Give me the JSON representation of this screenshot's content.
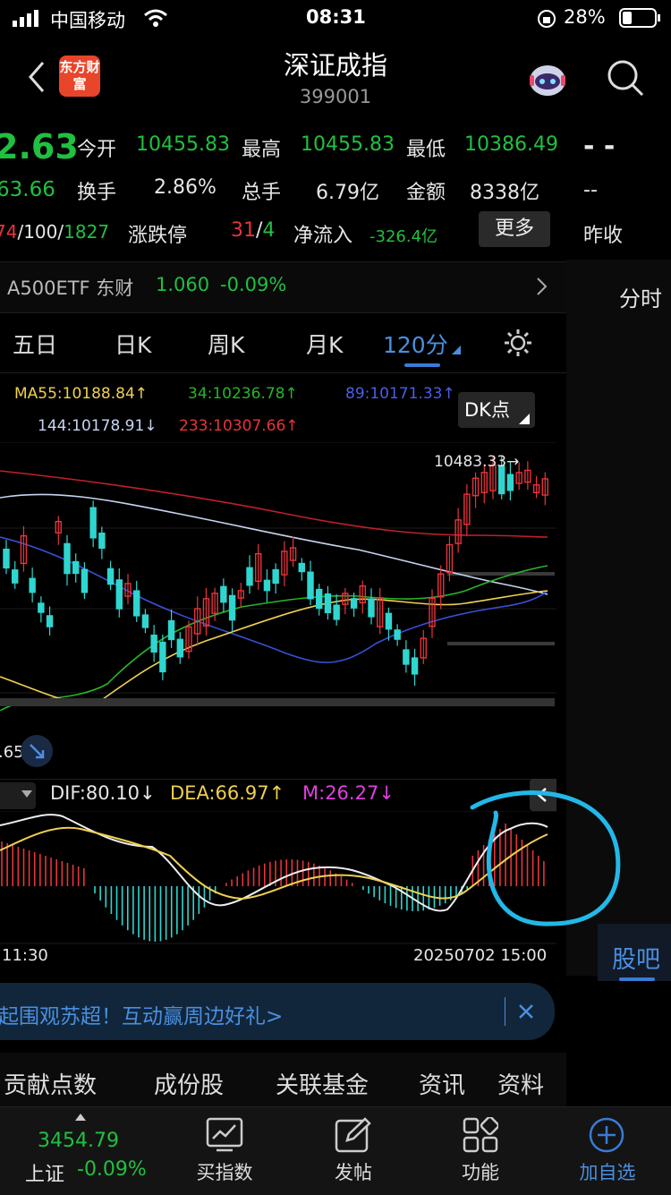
{
  "status_bar": {
    "carrier": "中国移动",
    "time": "08:31",
    "battery": "28%"
  },
  "header": {
    "logo_text": "东方财富",
    "title": "深证成指",
    "code": "399001"
  },
  "quote": {
    "price_partial": "2.63",
    "change_partial": "63.66",
    "open_label": "今开",
    "open": "10455.83",
    "high_label": "最高",
    "high": "10455.83",
    "low_label": "最低",
    "low": "10386.49",
    "turnover_label": "换手",
    "turnover": "2.86%",
    "volume_label": "总手",
    "volume": "6.79亿",
    "amount_label": "金额",
    "amount": "8338亿",
    "adv_up": "74",
    "adv_flat": "100",
    "adv_down": "1827",
    "limit_label": "涨跌停",
    "limit_up": "31",
    "limit_down": "4",
    "netflow_label": "净流入",
    "netflow": "-326.4亿",
    "more_label": "更多",
    "right_top": "- -",
    "right_mid": "--",
    "right_bottom": "昨收"
  },
  "etf": {
    "name": "A500ETF 东财",
    "price": "1.060",
    "change": "-0.09%"
  },
  "right_panel": {
    "tab_top": "分时",
    "tab_bottom": "股吧"
  },
  "chart_tabs": [
    {
      "label": "五日"
    },
    {
      "label": "日K"
    },
    {
      "label": "周K"
    },
    {
      "label": "月K"
    },
    {
      "label": "120分",
      "active": true
    }
  ],
  "ma_legend": {
    "ma55": "MA55:10188.84↑",
    "ma34": "34:10236.78↑",
    "ma89": "89:10171.33↑",
    "ma144": "144:10178.91↓",
    "ma233": "233:10307.66↑",
    "dk_label": "DK点"
  },
  "chart": {
    "max_label": "10483.33→",
    "low_label": ".65",
    "colors": {
      "up": "#e8333b",
      "down": "#2fd6d0",
      "ma55": "#f0d050",
      "ma34": "#28b428",
      "ma89": "#3a4fd8",
      "ma144": "#c8d4f0",
      "ma233": "#c0202a"
    }
  },
  "macd": {
    "dif": "DIF:80.10↓",
    "dea": "DEA:66.97↑",
    "m": "M:26.27↓",
    "time_left": "11:30",
    "time_right": "20250702 15:00"
  },
  "banner": {
    "text": "起围观苏超！互动赢周边好礼>"
  },
  "bottom_tabs": [
    {
      "label": "贡献点数"
    },
    {
      "label": "成份股"
    },
    {
      "label": "关联基金"
    },
    {
      "label": "资讯"
    },
    {
      "label": "资料"
    }
  ],
  "bottom_nav": {
    "index_value": "3454.79",
    "index_name": "上证",
    "index_change": "-0.09%",
    "buy_index": "买指数",
    "post": "发帖",
    "function": "功能",
    "add_watch": "加自选"
  }
}
